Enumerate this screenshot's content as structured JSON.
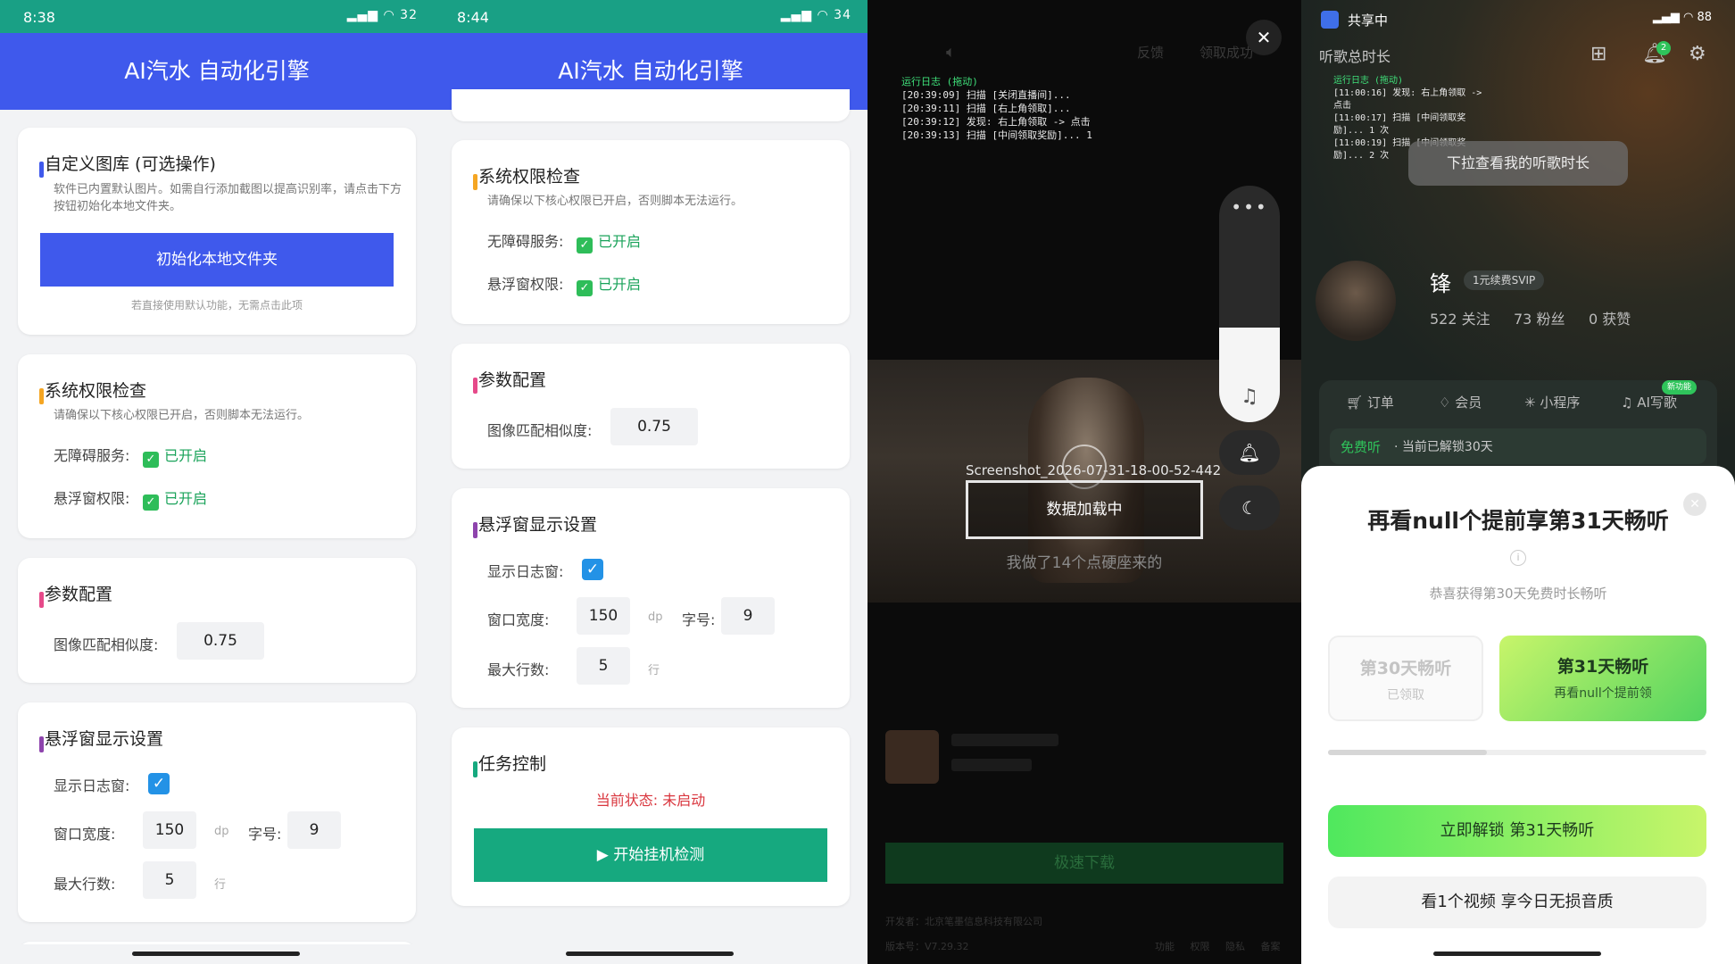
{
  "panel1": {
    "status_time": "8:38",
    "status_battery": "32",
    "app_title": "AI汽水 自动化引擎",
    "gallery": {
      "title": "自定义图库 (可选操作)",
      "hint": "软件已内置默认图片。如需自行添加截图以提高识别率，请点击下方按钮初始化本地文件夹。",
      "button": "初始化本地文件夹",
      "footnote": "若直接使用默认功能，无需点击此项"
    },
    "permissions": {
      "title": "系统权限检查",
      "hint": "请确保以下核心权限已开启，否则脚本无法运行。",
      "accessibility_label": "无障碍服务:",
      "accessibility_status": "已开启",
      "overlay_label": "悬浮窗权限:",
      "overlay_status": "已开启"
    },
    "params": {
      "title": "参数配置",
      "similarity_label": "图像匹配相似度:",
      "similarity_value": "0.75"
    },
    "float": {
      "title": "悬浮窗显示设置",
      "show_log_label": "显示日志窗:",
      "width_label": "窗口宽度:",
      "width_value": "150",
      "width_unit": "dp",
      "font_label": "字号:",
      "font_value": "9",
      "maxlines_label": "最大行数:",
      "maxlines_value": "5",
      "maxlines_unit": "行"
    }
  },
  "panel2": {
    "status_time": "8:44",
    "status_battery": "34",
    "app_title": "AI汽水 自动化引擎",
    "permissions": {
      "title": "系统权限检查",
      "hint": "请确保以下核心权限已开启，否则脚本无法运行。",
      "accessibility_label": "无障碍服务:",
      "accessibility_status": "已开启",
      "overlay_label": "悬浮窗权限:",
      "overlay_status": "已开启"
    },
    "params": {
      "title": "参数配置",
      "similarity_label": "图像匹配相似度:",
      "similarity_value": "0.75"
    },
    "float": {
      "title": "悬浮窗显示设置",
      "show_log_label": "显示日志窗:",
      "width_label": "窗口宽度:",
      "width_value": "150",
      "width_unit": "dp",
      "font_label": "字号:",
      "font_value": "9",
      "maxlines_label": "最大行数:",
      "maxlines_value": "5",
      "maxlines_unit": "行"
    },
    "task": {
      "title": "任务控制",
      "state": "当前状态: 未启动",
      "button": "▶ 开始挂机检测"
    }
  },
  "panel3": {
    "top_feedback": "反馈",
    "top_claimed": "领取成功",
    "log_title": "运行日志 (拖动)",
    "log_lines": [
      "[20:39:09] 扫描 [关闭直播间]...",
      "[20:39:11] 扫描 [右上角领取]...",
      "[20:39:12] 发现: 右上角领取 -> 点击",
      "[20:39:13] 扫描 [中间领取奖励]... 1"
    ],
    "screenshot_name": "Screenshot_2026-07-31-18-00-52-442",
    "loading": "数据加载中",
    "subtitle": "我做了14个点硬座来的",
    "download": "极速下载",
    "developer": "开发者：北京笔墨信息科技有限公司",
    "version": "版本号：V7.29.32",
    "footer_links": [
      "功能",
      "权限",
      "隐私",
      "备案"
    ]
  },
  "panel4": {
    "status_share": "共享中",
    "status_battery": "88",
    "listen_total": "听歌总时长",
    "log_title": "运行日志 (拖动)",
    "log_lines": [
      "[11:00:16] 发现: 右上角领取 -> 点击",
      "[11:00:17] 扫描 [中间领取奖励]... 1 次",
      "[11:00:19] 扫描 [中间领取奖励]... 2 次"
    ],
    "tooltip": "下拉查看我的听歌时长",
    "bell_badge": "2",
    "username": "锋",
    "vip_badge": "1元续费SVIP",
    "following": "522 关注",
    "fans": "73 粉丝",
    "likes": "0 获赞",
    "menu": [
      "订单",
      "会员",
      "小程序",
      "AI写歌"
    ],
    "new_badge": "新功能",
    "free_listen": "免费听",
    "free_listen_detail": "当前已解锁30天",
    "sheet": {
      "title": "再看null个提前享第31天畅听",
      "subtitle": "恭喜获得第30天免费时长畅听",
      "day30_title": "第30天畅听",
      "day30_sub": "已领取",
      "day31_title": "第31天畅听",
      "day31_sub": "再看null个提前领",
      "progress": 0.42,
      "unlock_button": "立即解锁 第31天畅听",
      "video_button": "看1个视频 享今日无损音质"
    }
  }
}
